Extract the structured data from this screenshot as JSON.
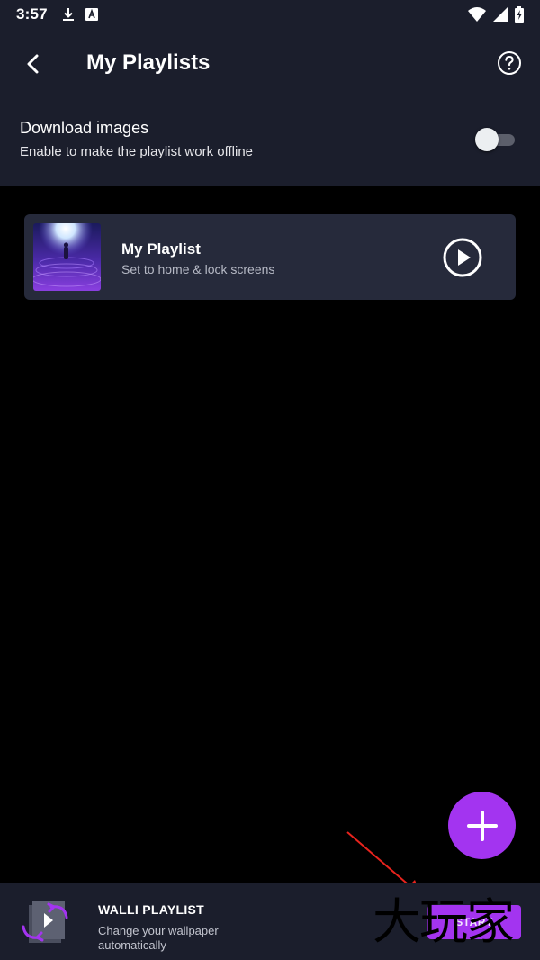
{
  "status_bar": {
    "time": "3:57",
    "left_icons": [
      "download-icon",
      "a-icon"
    ],
    "right_icons": [
      "wifi-icon",
      "signal-icon",
      "battery-icon"
    ]
  },
  "app_bar": {
    "back_icon": "back-arrow-icon",
    "title": "My Playlists",
    "help_icon": "help-icon"
  },
  "download_images": {
    "title": "Download images",
    "subtitle": "Enable to make the playlist work offline",
    "enabled": false
  },
  "playlists": [
    {
      "title": "My Playlist",
      "subtitle": "Set to home & lock screens",
      "thumbnail": "space-wallpaper-thumbnail",
      "action_icon": "play-icon"
    }
  ],
  "fab": {
    "icon": "plus-icon"
  },
  "bottom_bar": {
    "icon": "playlist-rotate-icon",
    "title": "WALLI PLAYLIST",
    "subtitle": "Change your wallpaper automatically",
    "button_label": "START"
  },
  "watermark": "大玩家",
  "colors": {
    "surface": "#1b1e2c",
    "card": "#262a3b",
    "accent": "#a334f0",
    "background": "#000000"
  }
}
